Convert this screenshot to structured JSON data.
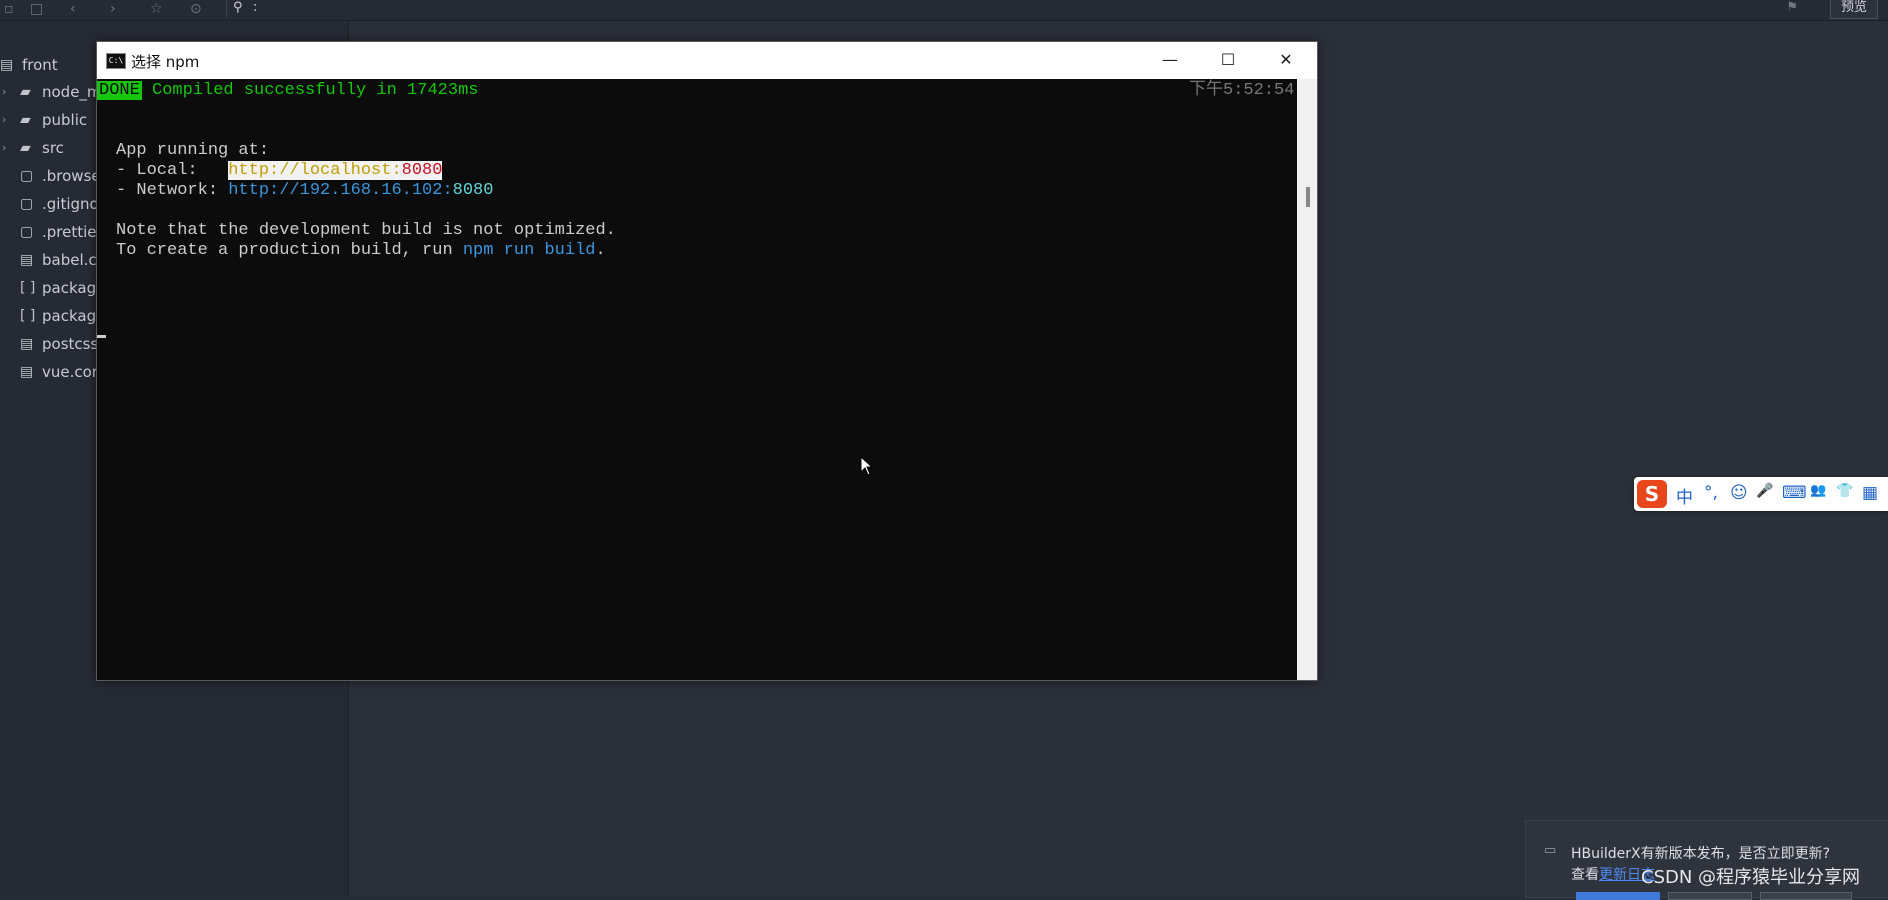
{
  "toolbar": {
    "icons": [
      "save-icon",
      "back-icon",
      "forward-icon",
      "star-icon",
      "run-icon"
    ],
    "search_value": ":",
    "preview_label": "预览"
  },
  "sidebar": {
    "root": "front",
    "items": [
      {
        "label": "node_m",
        "type": "folder"
      },
      {
        "label": "public",
        "type": "folder"
      },
      {
        "label": "src",
        "type": "folder"
      },
      {
        "label": ".browse",
        "type": "file"
      },
      {
        "label": ".gitigno",
        "type": "file"
      },
      {
        "label": ".prettie",
        "type": "file"
      },
      {
        "label": "babel.c",
        "type": "file"
      },
      {
        "label": "packag",
        "type": "json"
      },
      {
        "label": "packag",
        "type": "json"
      },
      {
        "label": "postcss",
        "type": "file"
      },
      {
        "label": "vue.cor",
        "type": "file"
      }
    ]
  },
  "terminal": {
    "title": "选择 npm",
    "icon_text": "C:\\",
    "lines": {
      "done_badge": "DONE",
      "compiled": " Compiled successfully in 17423ms",
      "time": "下午5:52:54",
      "app_running": "App running at:",
      "local_label": "- Local:   ",
      "local_url_host": "http://localhost:",
      "local_url_port": "8080",
      "network_label": "- Network: ",
      "network_url_host": "http://192.168.16.102:",
      "network_url_port": "8080",
      "note": "Note that the development build is not optimized.",
      "create_prefix": "To create a production build, run ",
      "create_cmd": "npm run build",
      "create_suffix": "."
    },
    "window_buttons": {
      "minimize": "—",
      "maximize": "☐",
      "close": "✕"
    }
  },
  "ime": {
    "logo": "S",
    "items": [
      "中",
      "°,",
      "☺",
      "🎤",
      "⌨",
      "👥",
      "👕",
      "▦"
    ]
  },
  "notification": {
    "text": "HBuilderX有新版本发布，是否立即更新?",
    "sub_prefix": "查看",
    "sub_link": "更新日志"
  },
  "watermark": "CSDN @程序猿毕业分享网"
}
